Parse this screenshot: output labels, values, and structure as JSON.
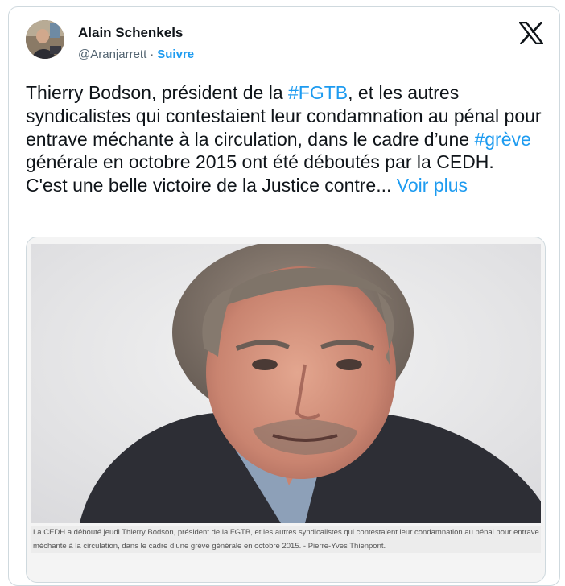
{
  "tweet": {
    "author_name": "Alain Schenkels",
    "handle": "@Aranjarrett",
    "separator": "·",
    "follow_label": "Suivre",
    "text_segments": [
      "Thierry Bodson, président de la ",
      "#FGTB",
      ", et les autres syndicalistes qui contestaient leur condamnation au pénal pour entrave méchante à la circulation, dans le cadre d’une ",
      "#grève",
      " générale en octobre 2015 ont été déboutés par la CEDH.",
      "C'est une belle victoire de la Justice contre... ",
      "Voir plus"
    ],
    "image_caption": "La CEDH a débouté jeudi Thierry Bodson, président de la FGTB, et les autres syndicalistes qui contestaient leur condamnation au pénal pour entrave méchante à la circulation, dans le cadre d’une grève générale en octobre 2015. - Pierre-Yves Thienpont."
  },
  "icons": {
    "platform_logo": "x-logo-icon",
    "avatar": "profile-photo"
  },
  "colors": {
    "link": "#1d9bf0",
    "text": "#0f1419",
    "muted": "#536471",
    "border": "#cfd9de"
  }
}
